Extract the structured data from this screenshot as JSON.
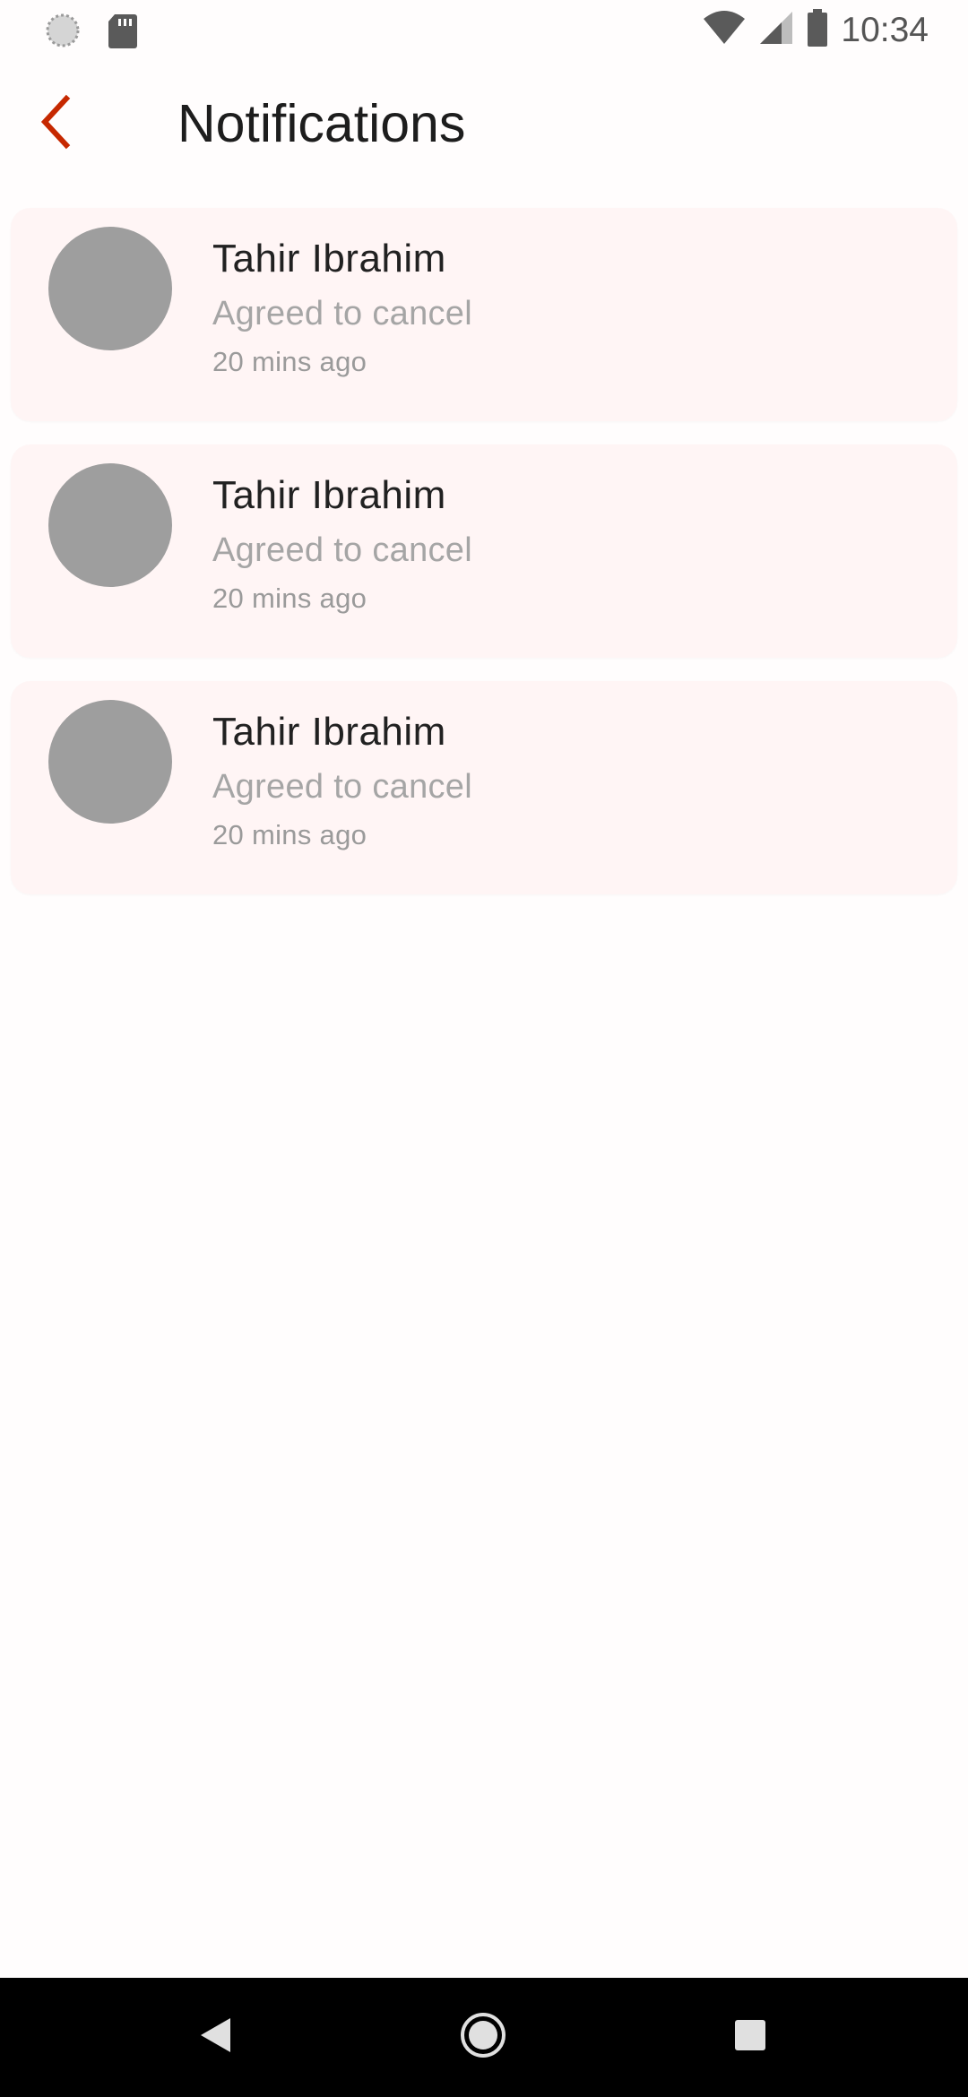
{
  "status_bar": {
    "time": "10:34",
    "left_icons": [
      "loading-circle-icon",
      "sd-card-icon"
    ],
    "right_icons": [
      "wifi-icon",
      "signal-icon",
      "battery-icon"
    ]
  },
  "app_bar": {
    "back_icon": "chevron-left-icon",
    "title": "Notifications"
  },
  "notifications": [
    {
      "name": "Tahir Ibrahim",
      "message": "Agreed to cancel",
      "time": "20 mins ago"
    },
    {
      "name": "Tahir Ibrahim",
      "message": "Agreed to cancel",
      "time": "20 mins ago"
    },
    {
      "name": "Tahir Ibrahim",
      "message": "Agreed to cancel",
      "time": "20 mins ago"
    }
  ],
  "nav_bar": {
    "buttons": [
      "back-triangle-icon",
      "home-circle-icon",
      "recents-square-icon"
    ]
  },
  "colors": {
    "accent": "#c62800",
    "card_background": "#fff5f5",
    "avatar_placeholder": "#9e9e9e"
  }
}
